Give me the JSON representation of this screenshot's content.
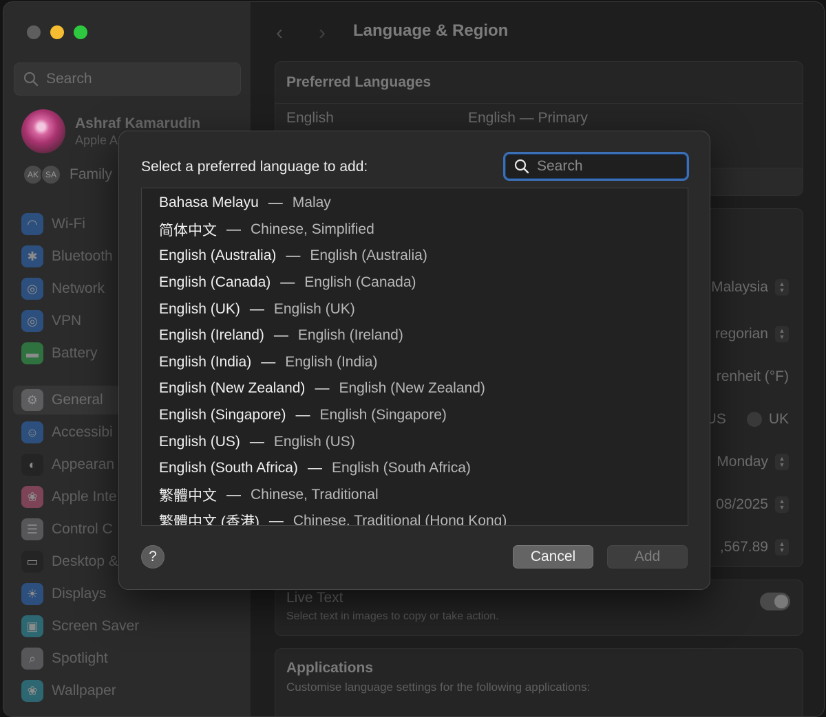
{
  "sidebar": {
    "search_placeholder": "Search",
    "profile": {
      "name": "Ashraf Kamarudin",
      "subtitle": "Apple A"
    },
    "family": {
      "avatars": [
        "AK",
        "SA"
      ],
      "label": "Family"
    },
    "items": [
      {
        "label": "Wi-Fi",
        "icon": "wifi-icon",
        "color": "#2f7ce0"
      },
      {
        "label": "Bluetooth",
        "icon": "bluetooth-icon",
        "color": "#2f7ce0"
      },
      {
        "label": "Network",
        "icon": "globe-icon",
        "color": "#2f7ce0"
      },
      {
        "label": "VPN",
        "icon": "vpn-globe-icon",
        "color": "#2f7ce0"
      },
      {
        "label": "Battery",
        "icon": "battery-icon",
        "color": "#34c759"
      },
      {
        "label": "General",
        "icon": "gear-icon",
        "color": "#8e8e93"
      },
      {
        "label": "Accessibi",
        "icon": "accessibility-icon",
        "color": "#2f7ce0"
      },
      {
        "label": "Appearan",
        "icon": "appearance-icon",
        "color": "#1c1c1e"
      },
      {
        "label": "Apple Inte",
        "icon": "apple-intelligence-icon",
        "color": "#e0608a"
      },
      {
        "label": "Control C",
        "icon": "control-centre-icon",
        "color": "#8e8e93"
      },
      {
        "label": "Desktop &",
        "icon": "desktop-dock-icon",
        "color": "#1c1c1e"
      },
      {
        "label": "Displays",
        "icon": "displays-icon",
        "color": "#2f7ce0"
      },
      {
        "label": "Screen Saver",
        "icon": "screen-saver-icon",
        "color": "#30b0c7"
      },
      {
        "label": "Spotlight",
        "icon": "spotlight-icon",
        "color": "#8e8e93"
      },
      {
        "label": "Wallpaper",
        "icon": "wallpaper-icon",
        "color": "#30b0c7"
      }
    ]
  },
  "main": {
    "title": "Language & Region",
    "preferred_languages": {
      "header": "Preferred Languages",
      "rows": [
        {
          "name": "English",
          "detail": "English — Primary"
        }
      ]
    },
    "region_values": {
      "region": "Malaysia",
      "calendar": "regorian",
      "temperature": "renheit (°F)",
      "measurement_a": "US",
      "measurement_b": "UK",
      "first_day": "Monday",
      "date_format": "08/2025",
      "number_format": ",567.89"
    },
    "live_text": {
      "title": "Live Text",
      "subtitle": "Select text in images to copy or take action."
    },
    "applications": {
      "title": "Applications",
      "subtitle": "Customise language settings for the following applications:"
    }
  },
  "dialog": {
    "title": "Select a preferred language to add:",
    "search_placeholder": "Search",
    "languages": [
      {
        "native": "Bahasa Melayu",
        "english": "Malay"
      },
      {
        "native": "简体中文",
        "english": "Chinese, Simplified"
      },
      {
        "native": "English (Australia)",
        "english": "English (Australia)"
      },
      {
        "native": "English (Canada)",
        "english": "English (Canada)"
      },
      {
        "native": "English (UK)",
        "english": "English (UK)"
      },
      {
        "native": "English (Ireland)",
        "english": "English (Ireland)"
      },
      {
        "native": "English (India)",
        "english": "English (India)"
      },
      {
        "native": "English (New Zealand)",
        "english": "English (New Zealand)"
      },
      {
        "native": "English (Singapore)",
        "english": "English (Singapore)"
      },
      {
        "native": "English (US)",
        "english": "English (US)"
      },
      {
        "native": "English (South Africa)",
        "english": "English (South Africa)"
      },
      {
        "native": "繁體中文",
        "english": "Chinese, Traditional"
      },
      {
        "native": "繁體中文 (香港)",
        "english": "Chinese, Traditional (Hong Kong)"
      }
    ],
    "separator": "—",
    "help_label": "?",
    "cancel_label": "Cancel",
    "add_label": "Add"
  }
}
